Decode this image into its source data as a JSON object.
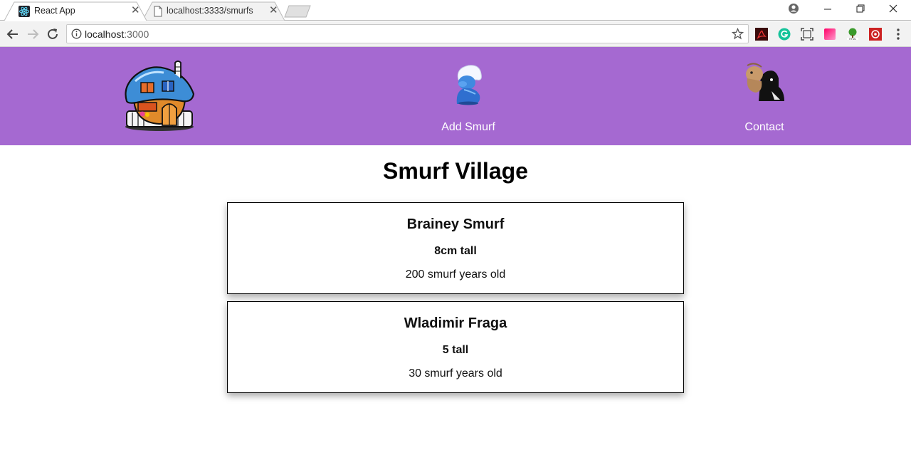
{
  "browser": {
    "tabs": [
      {
        "title": "React App",
        "favicon": "react-icon",
        "active": true
      },
      {
        "title": "localhost:3333/smurfs",
        "favicon": "page-icon",
        "active": false
      }
    ],
    "address_host": "localhost",
    "address_port": ":3000",
    "extensions": [
      "pdf-icon",
      "grammarly-icon",
      "screenshot-icon",
      "color-icon",
      "html-tree-icon",
      "red-extension-icon"
    ]
  },
  "header": {
    "logo_icon": "smurf-house-icon",
    "nav": [
      {
        "label": "Add Smurf",
        "icon": "smurf-icon"
      },
      {
        "label": "Contact",
        "icon": "contact-icon"
      }
    ]
  },
  "main": {
    "title": "Smurf Village",
    "smurfs": [
      {
        "name": "Brainey Smurf",
        "height": "8cm tall",
        "age": "200 smurf years old"
      },
      {
        "name": "Wladimir Fraga",
        "height": "5 tall",
        "age": "30 smurf years old"
      }
    ]
  },
  "colors": {
    "header_bg": "#a569d1",
    "tab_strip_bg": "#ffffff",
    "toolbar_bg": "#f2f2f2"
  }
}
